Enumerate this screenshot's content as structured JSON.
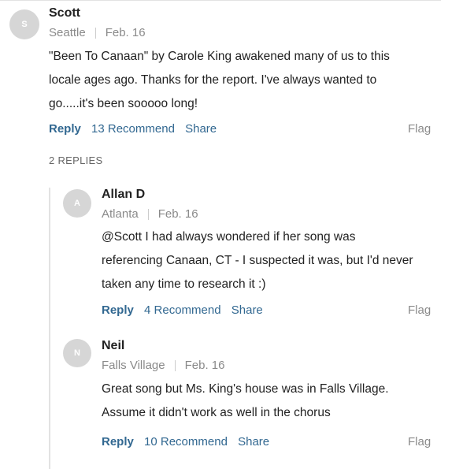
{
  "comments": [
    {
      "avatar_initial": "S",
      "name": "Scott",
      "location": "Seattle",
      "date": "Feb. 16",
      "body_lines": [
        "\"Been To Canaan\" by Carole King awakened many of us to this",
        "locale ages ago.  Thanks for the report.  I've always wanted to",
        "go.....it's been sooooo long!"
      ],
      "reply_label": "Reply",
      "recommend_label": "13 Recommend",
      "share_label": "Share",
      "flag_label": "Flag"
    }
  ],
  "replies_label": "2 REPLIES",
  "replies": [
    {
      "avatar_initial": "A",
      "name": "Allan D",
      "location": "Atlanta",
      "date": "Feb. 16",
      "body_lines": [
        "@Scott   I had always wondered if her song was",
        "referencing Canaan, CT - I suspected it was, but I'd never",
        "taken any time to research it :)"
      ],
      "reply_label": "Reply",
      "recommend_label": "4 Recommend",
      "share_label": "Share",
      "flag_label": "Flag"
    },
    {
      "avatar_initial": "N",
      "name": "Neil",
      "location": "Falls Village",
      "date": "Feb. 16",
      "body_lines": [
        "Great song but Ms. King's house was in Falls Village.",
        "Assume it didn't work as well in the chorus"
      ],
      "reply_label": "Reply",
      "recommend_label": "10 Recommend",
      "share_label": "Share",
      "flag_label": "Flag"
    }
  ]
}
